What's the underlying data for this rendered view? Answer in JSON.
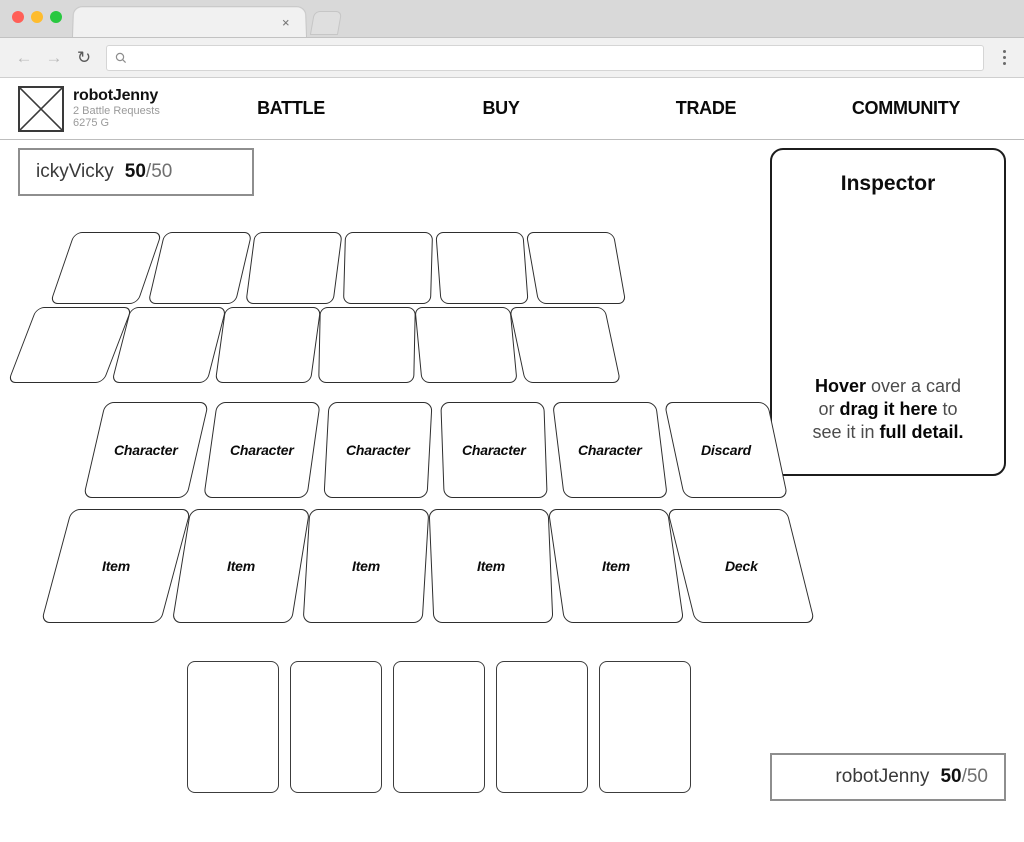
{
  "browser": {
    "tab_close_label": "×",
    "url_value": "",
    "url_placeholder": "",
    "back_glyph": "←",
    "forward_glyph": "→",
    "reload_glyph": "↻"
  },
  "header": {
    "brand_name": "robotJenny",
    "brand_requests": "2 Battle Requests",
    "brand_gold": "6275 G",
    "nav": [
      {
        "label": "BATTLE"
      },
      {
        "label": "BUY"
      },
      {
        "label": "TRADE"
      },
      {
        "label": "COMMUNITY"
      }
    ]
  },
  "opponent_hp": {
    "name": "ickyVicky",
    "current": "50",
    "separator": "/",
    "max": "50"
  },
  "player_hp": {
    "name": "robotJenny",
    "current": "50",
    "separator": "/",
    "max": "50"
  },
  "inspector": {
    "title": "Inspector",
    "hint_line1_strong": "Hover",
    "hint_line1_rest": " over a card",
    "hint_line2_pre": "or ",
    "hint_line2_strong": "drag it here",
    "hint_line2_post": " to",
    "hint_line3_pre": "see it in ",
    "hint_line3_strong": "full detail."
  },
  "board": {
    "opponent_row_back": [
      {
        "label": ""
      },
      {
        "label": ""
      },
      {
        "label": ""
      },
      {
        "label": ""
      },
      {
        "label": ""
      },
      {
        "label": ""
      }
    ],
    "opponent_row_front": [
      {
        "label": ""
      },
      {
        "label": ""
      },
      {
        "label": ""
      },
      {
        "label": ""
      },
      {
        "label": ""
      },
      {
        "label": ""
      }
    ],
    "player_character_row": [
      {
        "label": "Character"
      },
      {
        "label": "Character"
      },
      {
        "label": "Character"
      },
      {
        "label": "Character"
      },
      {
        "label": "Character"
      },
      {
        "label": "Discard"
      }
    ],
    "player_item_row": [
      {
        "label": "Item"
      },
      {
        "label": "Item"
      },
      {
        "label": "Item"
      },
      {
        "label": "Item"
      },
      {
        "label": "Item"
      },
      {
        "label": "Deck"
      }
    ],
    "hand": [
      {
        "label": ""
      },
      {
        "label": ""
      },
      {
        "label": ""
      },
      {
        "label": ""
      },
      {
        "label": ""
      }
    ]
  },
  "colors": {
    "ink": "#111111",
    "muted": "#9a9a9a",
    "card_border": "#2e2e2e",
    "hp_border": "#8e8e8e"
  }
}
